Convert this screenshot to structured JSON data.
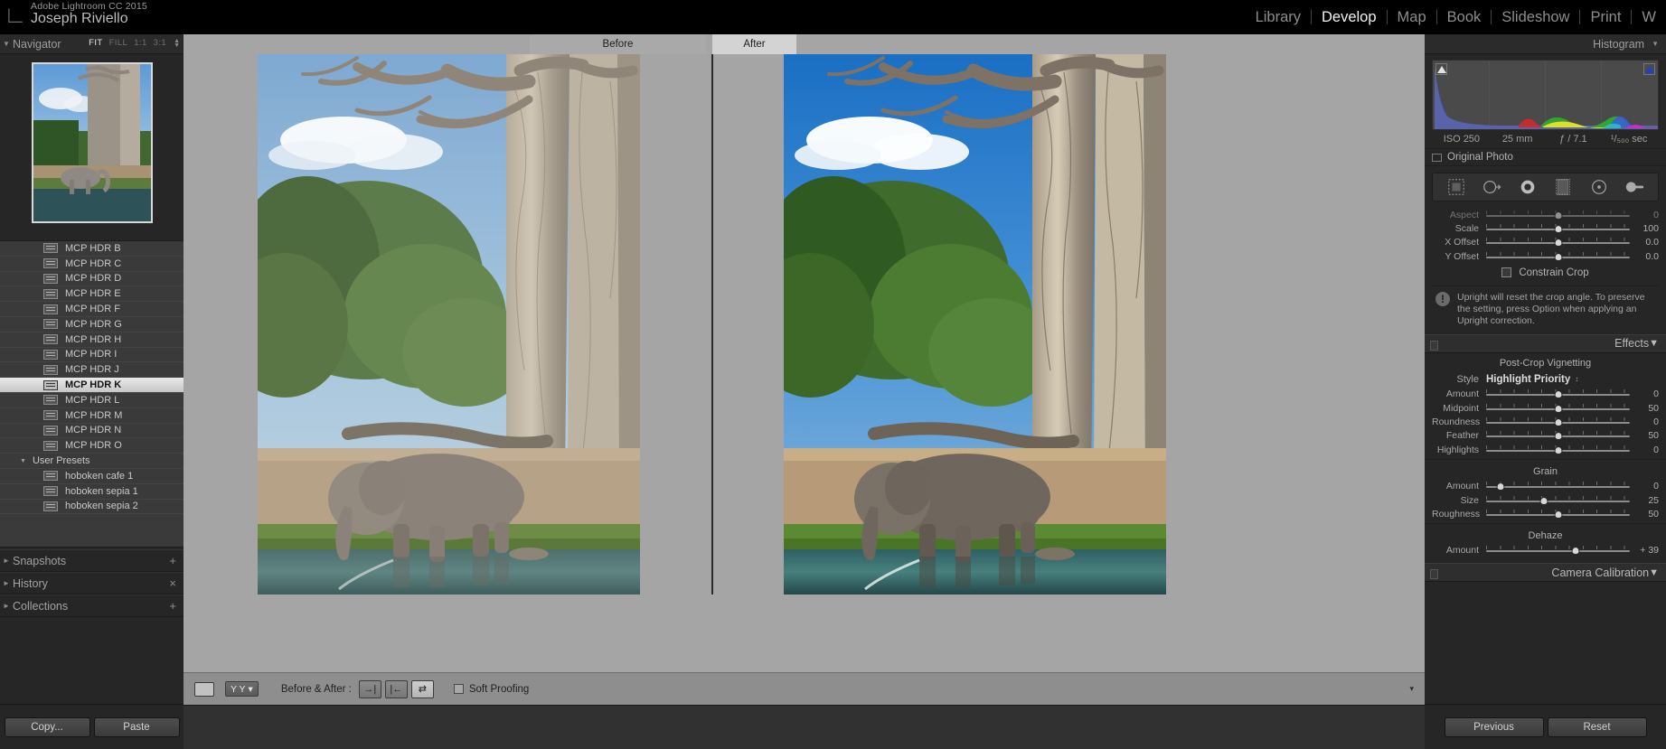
{
  "app": {
    "name": "Adobe Lightroom CC 2015",
    "document": "Joseph Riviello",
    "logo": "lightroom-logo"
  },
  "modules": [
    {
      "label": "Library",
      "active": false
    },
    {
      "label": "Develop",
      "active": true
    },
    {
      "label": "Map",
      "active": false
    },
    {
      "label": "Book",
      "active": false
    },
    {
      "label": "Slideshow",
      "active": false
    },
    {
      "label": "Print",
      "active": false
    },
    {
      "label": "W",
      "active": false
    }
  ],
  "navigator": {
    "title": "Navigator",
    "zoom_levels": [
      {
        "label": "FIT",
        "active": true
      },
      {
        "label": "FILL",
        "active": false
      },
      {
        "label": "1:1",
        "active": false
      },
      {
        "label": "3:1",
        "active": false
      }
    ]
  },
  "presets": [
    {
      "label": "MCP HDR B",
      "type": "preset",
      "selected": false
    },
    {
      "label": "MCP HDR C",
      "type": "preset",
      "selected": false
    },
    {
      "label": "MCP HDR D",
      "type": "preset",
      "selected": false
    },
    {
      "label": "MCP HDR E",
      "type": "preset",
      "selected": false
    },
    {
      "label": "MCP HDR F",
      "type": "preset",
      "selected": false
    },
    {
      "label": "MCP HDR G",
      "type": "preset",
      "selected": false
    },
    {
      "label": "MCP HDR H",
      "type": "preset",
      "selected": false
    },
    {
      "label": "MCP HDR I",
      "type": "preset",
      "selected": false
    },
    {
      "label": "MCP HDR J",
      "type": "preset",
      "selected": false
    },
    {
      "label": "MCP HDR K",
      "type": "preset",
      "selected": true
    },
    {
      "label": "MCP HDR L",
      "type": "preset",
      "selected": false
    },
    {
      "label": "MCP HDR M",
      "type": "preset",
      "selected": false
    },
    {
      "label": "MCP HDR N",
      "type": "preset",
      "selected": false
    },
    {
      "label": "MCP HDR O",
      "type": "preset",
      "selected": false
    },
    {
      "label": "User Presets",
      "type": "group",
      "selected": false
    },
    {
      "label": "hoboken cafe 1",
      "type": "preset",
      "selected": false
    },
    {
      "label": "hoboken sepia 1",
      "type": "preset",
      "selected": false
    },
    {
      "label": "hoboken sepia 2",
      "type": "preset",
      "selected": false
    }
  ],
  "left_panels": [
    {
      "label": "Snapshots",
      "action": "+"
    },
    {
      "label": "History",
      "action": "×"
    },
    {
      "label": "Collections",
      "action": "+"
    }
  ],
  "left_buttons": {
    "copy": "Copy...",
    "paste": "Paste"
  },
  "preview": {
    "before_label": "Before",
    "after_label": "After"
  },
  "toolbar": {
    "view_icon": "loupe-view-icon",
    "flag_label": "Y Y",
    "before_after_label": "Before & After :",
    "modes": [
      {
        "icon": "copy-settings-right-icon",
        "active": false
      },
      {
        "icon": "copy-settings-left-icon",
        "active": false
      },
      {
        "icon": "swap-before-after-icon",
        "active": true
      }
    ],
    "soft_proofing_label": "Soft Proofing",
    "soft_proofing_checked": false,
    "caret": "▾"
  },
  "histogram": {
    "title": "Histogram",
    "exif": {
      "iso": "ISO 250",
      "focal": "25 mm",
      "aperture": "ƒ / 7.1",
      "shutter": "¹/₅₀₀ sec"
    },
    "original_photo_label": "Original Photo",
    "original_photo_checked": false,
    "shadow_clip": "shadow-clipping-indicator",
    "highlight_clip": "highlight-clipping-indicator"
  },
  "tools": [
    {
      "icon": "crop-overlay-icon"
    },
    {
      "icon": "spot-removal-icon"
    },
    {
      "icon": "red-eye-correction-icon"
    },
    {
      "icon": "graduated-filter-icon"
    },
    {
      "icon": "radial-filter-icon"
    },
    {
      "icon": "adjustment-brush-icon"
    }
  ],
  "transform": {
    "sliders": [
      {
        "label": "Aspect",
        "value": "0",
        "pos": 50
      },
      {
        "label": "Scale",
        "value": "100",
        "pos": 50
      },
      {
        "label": "X Offset",
        "value": "0.0",
        "pos": 50
      },
      {
        "label": "Y Offset",
        "value": "0.0",
        "pos": 50
      }
    ],
    "constrain_crop_label": "Constrain Crop",
    "constrain_crop_checked": false,
    "warning": "Upright will reset the crop angle. To preserve the setting, press Option when applying an Upright correction."
  },
  "effects": {
    "title": "Effects",
    "post_crop_title": "Post-Crop Vignetting",
    "style_label": "Style",
    "style_value": "Highlight Priority",
    "vignette_sliders": [
      {
        "label": "Amount",
        "value": "0",
        "pos": 50
      },
      {
        "label": "Midpoint",
        "value": "50",
        "pos": 50
      },
      {
        "label": "Roundness",
        "value": "0",
        "pos": 50
      },
      {
        "label": "Feather",
        "value": "50",
        "pos": 50
      },
      {
        "label": "Highlights",
        "value": "0",
        "pos": 50
      }
    ],
    "grain_title": "Grain",
    "grain_sliders": [
      {
        "label": "Amount",
        "value": "0",
        "pos": 10
      },
      {
        "label": "Size",
        "value": "25",
        "pos": 40
      },
      {
        "label": "Roughness",
        "value": "50",
        "pos": 50
      }
    ],
    "dehaze_title": "Dehaze",
    "dehaze_sliders": [
      {
        "label": "Amount",
        "value": "+ 39",
        "pos": 62
      }
    ]
  },
  "camera_calibration": {
    "title": "Camera Calibration"
  },
  "right_buttons": {
    "previous": "Previous",
    "reset": "Reset"
  },
  "colors": {
    "panel_bg": "#262626",
    "center_bg": "#a5a5a5",
    "highlight": "#e9e9e9",
    "text": "#bbbbbb"
  }
}
